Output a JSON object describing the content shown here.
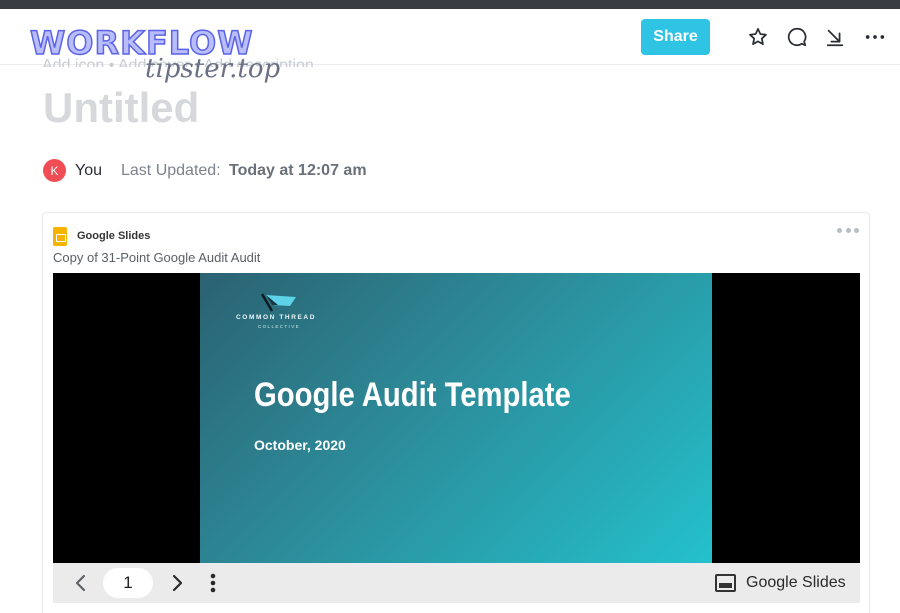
{
  "watermark": {
    "text": "WORKFLOW",
    "subtext": "tipster.top"
  },
  "header": {
    "share_label": "Share",
    "icons": [
      "star-icon",
      "comment-icon",
      "download-icon",
      "more-icon"
    ]
  },
  "ghost_text": "Add icon • Add cover • Add description",
  "document": {
    "title": "Untitled",
    "author_initial": "K",
    "author": "You",
    "updated_label": "Last Updated:",
    "updated_value": "Today at 12:07 am"
  },
  "embed": {
    "provider": "Google Slides",
    "file_title": "Copy of 31-Point Google Audit Audit",
    "slide": {
      "logo_text": "COMMON THREAD",
      "logo_sub": "COLLECTIVE",
      "title": "Google Audit Template",
      "date": "October, 2020"
    },
    "controls": {
      "page_number": "1",
      "brand_label": "Google Slides"
    }
  },
  "colors": {
    "accent": "#2fc4e3",
    "avatar": "#f04d54",
    "slide_gradient_start": "#2b6272",
    "slide_gradient_end": "#23c1cc",
    "slides_icon": "#f6b400"
  }
}
